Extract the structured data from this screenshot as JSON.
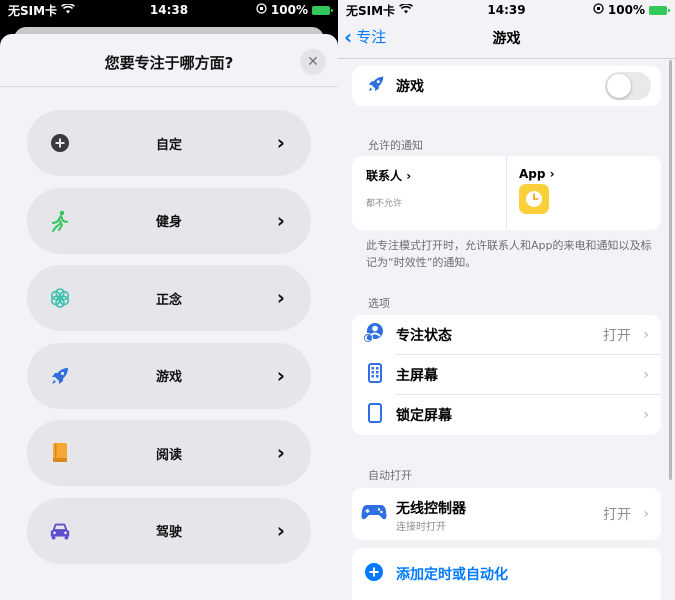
{
  "left": {
    "status": {
      "carrier": "无SIM卡",
      "time": "14:38",
      "battery": "100%"
    },
    "sheet": {
      "title": "您要专注于哪方面?",
      "close_symbol": "✕",
      "items": [
        {
          "label": "自定",
          "icon": "plus-circle-icon"
        },
        {
          "label": "健身",
          "icon": "running-person-icon"
        },
        {
          "label": "正念",
          "icon": "flower-icon"
        },
        {
          "label": "游戏",
          "icon": "rocket-icon"
        },
        {
          "label": "阅读",
          "icon": "book-icon"
        },
        {
          "label": "驾驶",
          "icon": "car-icon"
        }
      ]
    }
  },
  "right": {
    "status": {
      "carrier": "无SIM卡",
      "time": "14:39",
      "battery": "100%"
    },
    "nav": {
      "back_label": "专注",
      "title": "游戏"
    },
    "mode_row": {
      "label": "游戏",
      "toggle_on": false
    },
    "allowed": {
      "section_label": "允许的通知",
      "people_title": "联系人",
      "people_sub": "都不允许",
      "apps_title": "App"
    },
    "note": "此专注模式打开时，允许联系人和App的来电和通知以及标记为“时效性”的通知。",
    "options": {
      "section_label": "选项",
      "rows": [
        {
          "label": "专注状态",
          "value": "打开",
          "icon": "focus-status-icon"
        },
        {
          "label": "主屏幕",
          "value": "",
          "icon": "home-screen-icon"
        },
        {
          "label": "锁定屏幕",
          "value": "",
          "icon": "lock-screen-icon"
        }
      ]
    },
    "auto": {
      "section_label": "自动打开",
      "controller_label": "无线控制器",
      "controller_sub": "连接时打开",
      "controller_value": "打开",
      "add_label": "添加定时或自动化"
    }
  },
  "colors": {
    "accent": "#007aff",
    "toggle_off": "#e9e9eb",
    "app_icon": "#f9cf3a",
    "sheet_bg": "#f2f2f7"
  }
}
